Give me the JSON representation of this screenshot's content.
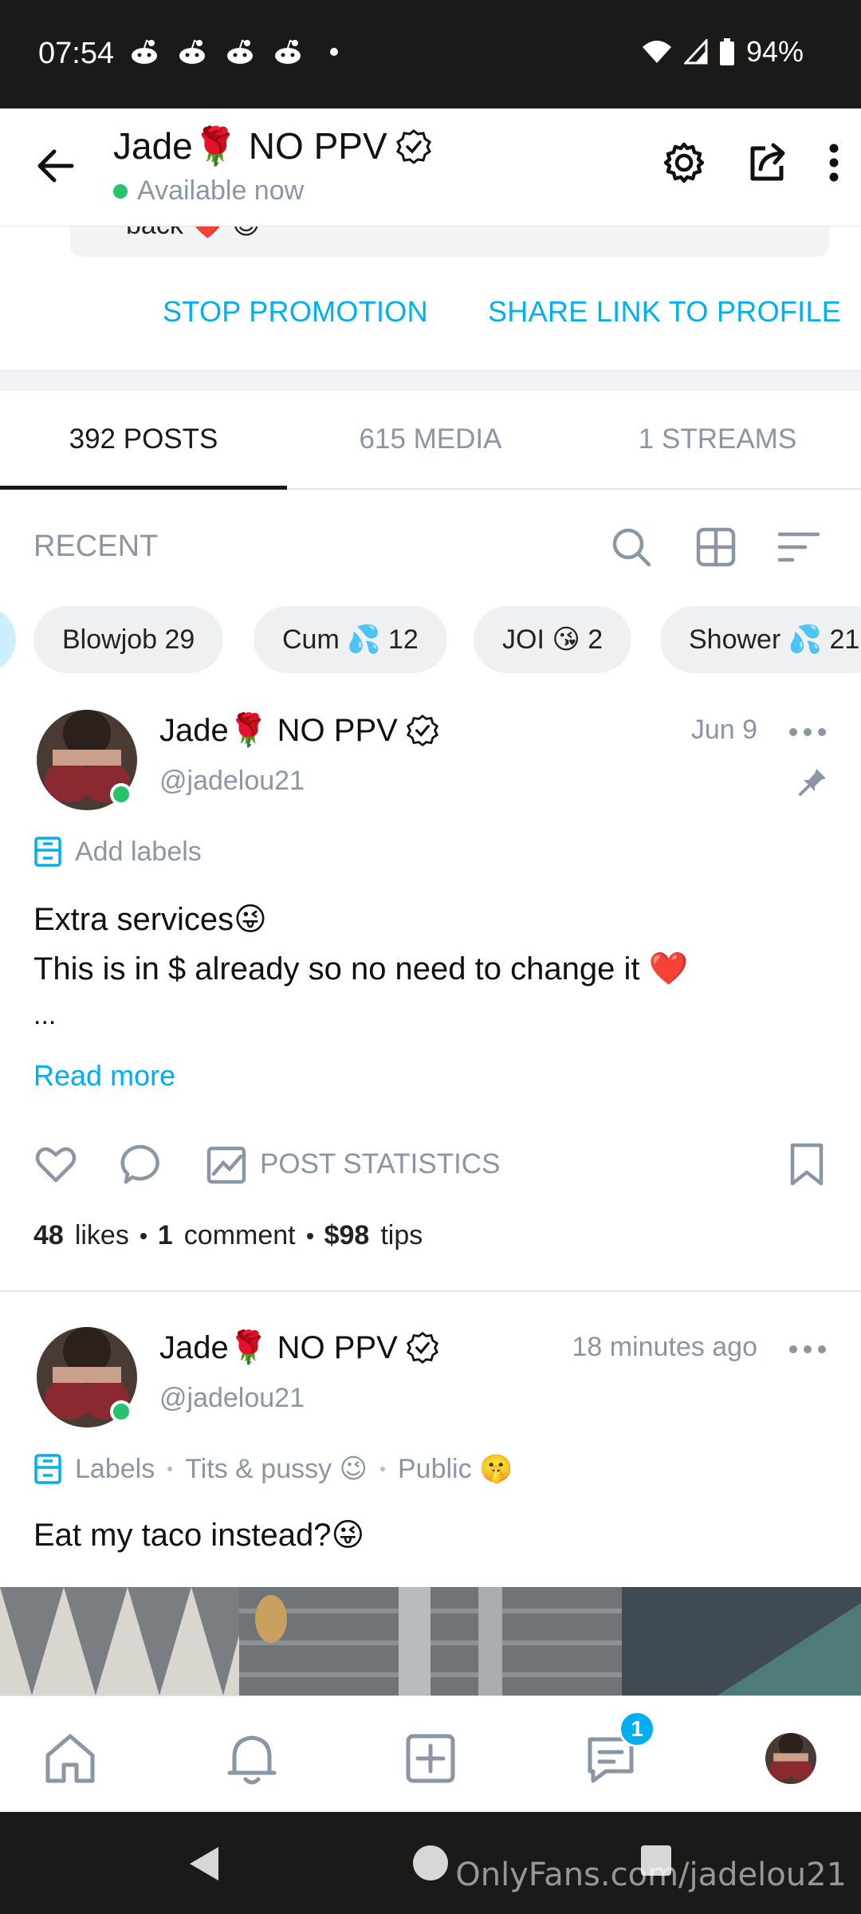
{
  "status_bar": {
    "time": "07:54",
    "battery": "94%",
    "notification_icons": [
      "reddit-icon",
      "reddit-icon",
      "reddit-icon",
      "reddit-icon"
    ]
  },
  "header": {
    "name": "Jade🌹 NO PPV",
    "availability": "Available now"
  },
  "promo": {
    "partial_text": "back ❤️ 😉",
    "stop_label": "STOP PROMOTION",
    "share_label": "SHARE LINK TO PROFILE"
  },
  "tabs": [
    {
      "label": "392 POSTS",
      "active": true
    },
    {
      "label": "615 MEDIA",
      "active": false
    },
    {
      "label": "1 STREAMS",
      "active": false
    }
  ],
  "recent": {
    "label": "RECENT"
  },
  "chips": [
    {
      "label": "Blowjob 29"
    },
    {
      "label": "Cum 💦 12"
    },
    {
      "label": "JOI 😘 2"
    },
    {
      "label": "Shower 💦 21"
    }
  ],
  "posts": [
    {
      "name": "Jade🌹 NO PPV",
      "handle": "@jadelou21",
      "date": "Jun 9",
      "pinned": true,
      "labels_text": "Add labels",
      "text_lines": [
        "Extra services😜",
        "This is in $ already so no need to change it ❤️",
        "..."
      ],
      "read_more": "Read more",
      "post_statistics": "POST STATISTICS",
      "likes_count": "48",
      "likes_word": "likes",
      "comments_count": "1",
      "comments_word": "comment",
      "tips_amount": "$98",
      "tips_word": "tips"
    },
    {
      "name": "Jade🌹 NO PPV",
      "handle": "@jadelou21",
      "date": "18 minutes ago",
      "labels_text": "Labels",
      "label_1": "Tits & pussy 😉",
      "label_2": "Public 🤫",
      "text": "Eat my taco instead?😜"
    }
  ],
  "bottom_nav": {
    "messages_badge": "1"
  },
  "watermark": "OnlyFans.com/jadelou21",
  "colors": {
    "accent": "#00aff0",
    "muted": "#8a96a3",
    "online": "#25c46b",
    "system_bar": "#1b1a18"
  }
}
